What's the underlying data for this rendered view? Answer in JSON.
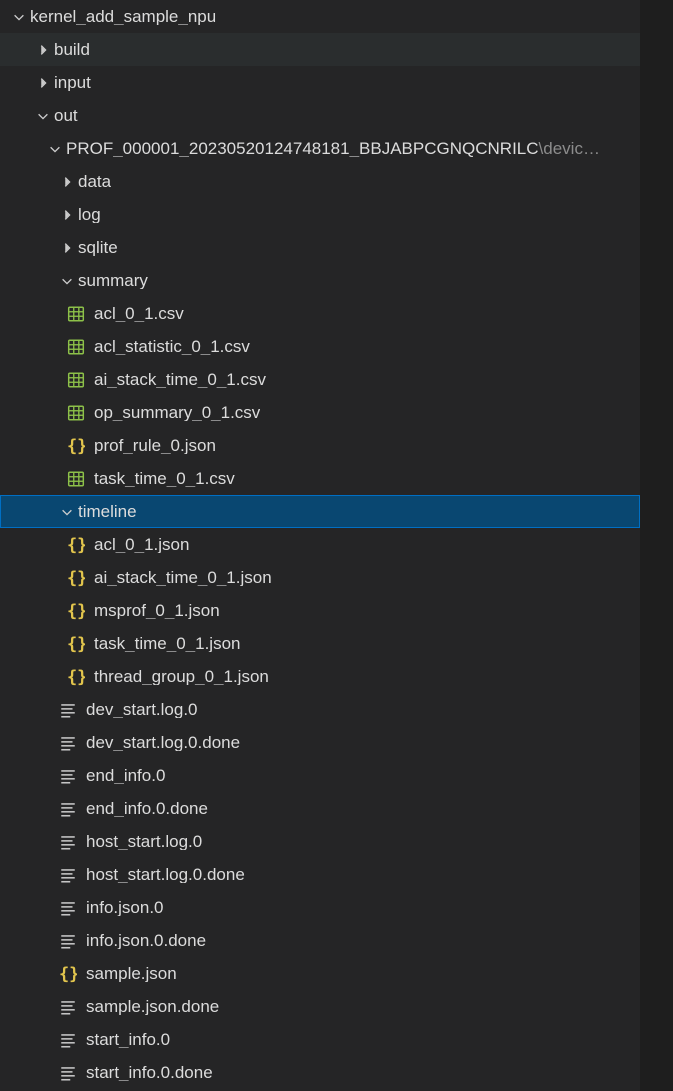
{
  "root": {
    "label": "kernel_add_sample_npu"
  },
  "folders": {
    "build": "build",
    "input": "input",
    "out": "out",
    "prof": "PROF_000001_20230520124748181_BBJABPCGNQCNRILC",
    "prof_suffix": "\\devic…",
    "data": "data",
    "log": "log",
    "sqlite": "sqlite",
    "summary": "summary",
    "timeline": "timeline"
  },
  "summary_files": [
    {
      "name": "acl_0_1.csv",
      "icon": "csv"
    },
    {
      "name": "acl_statistic_0_1.csv",
      "icon": "csv"
    },
    {
      "name": "ai_stack_time_0_1.csv",
      "icon": "csv"
    },
    {
      "name": "op_summary_0_1.csv",
      "icon": "csv"
    },
    {
      "name": "prof_rule_0.json",
      "icon": "json"
    },
    {
      "name": "task_time_0_1.csv",
      "icon": "csv"
    }
  ],
  "timeline_files": [
    {
      "name": "acl_0_1.json",
      "icon": "json"
    },
    {
      "name": "ai_stack_time_0_1.json",
      "icon": "json"
    },
    {
      "name": "msprof_0_1.json",
      "icon": "json"
    },
    {
      "name": "task_time_0_1.json",
      "icon": "json"
    },
    {
      "name": "thread_group_0_1.json",
      "icon": "json"
    }
  ],
  "prof_files": [
    {
      "name": "dev_start.log.0",
      "icon": "text"
    },
    {
      "name": "dev_start.log.0.done",
      "icon": "text"
    },
    {
      "name": "end_info.0",
      "icon": "text"
    },
    {
      "name": "end_info.0.done",
      "icon": "text"
    },
    {
      "name": "host_start.log.0",
      "icon": "text"
    },
    {
      "name": "host_start.log.0.done",
      "icon": "text"
    },
    {
      "name": "info.json.0",
      "icon": "text"
    },
    {
      "name": "info.json.0.done",
      "icon": "text"
    },
    {
      "name": "sample.json",
      "icon": "json"
    },
    {
      "name": "sample.json.done",
      "icon": "text"
    },
    {
      "name": "start_info.0",
      "icon": "text"
    },
    {
      "name": "start_info.0.done",
      "icon": "text"
    }
  ]
}
